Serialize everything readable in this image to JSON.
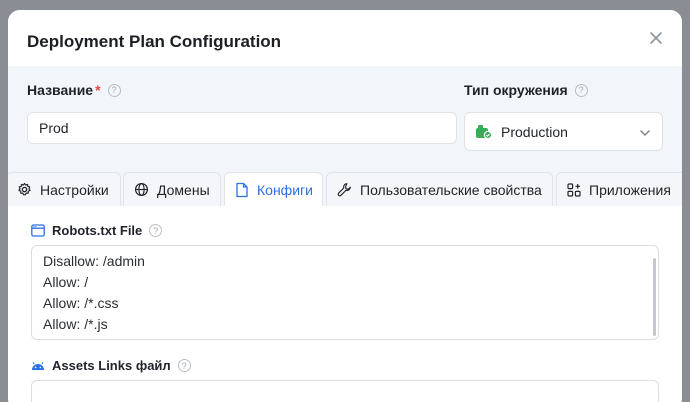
{
  "modal": {
    "title": "Deployment Plan Configuration"
  },
  "form": {
    "name_label": "Название",
    "name_required_mark": "*",
    "name_value": "Prod",
    "env_label": "Тип окружения",
    "env_value": "Production",
    "help_glyph": "?"
  },
  "tabs": [
    {
      "label": "Настройки",
      "icon": "gear-icon"
    },
    {
      "label": "Домены",
      "icon": "globe-icon"
    },
    {
      "label": "Конфиги",
      "icon": "file-icon",
      "active": true
    },
    {
      "label": "Пользовательские свойства",
      "icon": "wrench-icon"
    },
    {
      "label": "Приложения",
      "icon": "apps-icon"
    }
  ],
  "robots": {
    "label": "Robots.txt File",
    "lines": [
      "Disallow: /admin",
      "Allow: /",
      "Allow: /*.css",
      "Allow: /*.js"
    ]
  },
  "assets": {
    "label": "Assets Links файл",
    "value": ""
  },
  "colors": {
    "accent": "#2b6fe5",
    "required": "#e54545",
    "env_icon": "#3bab5a"
  }
}
